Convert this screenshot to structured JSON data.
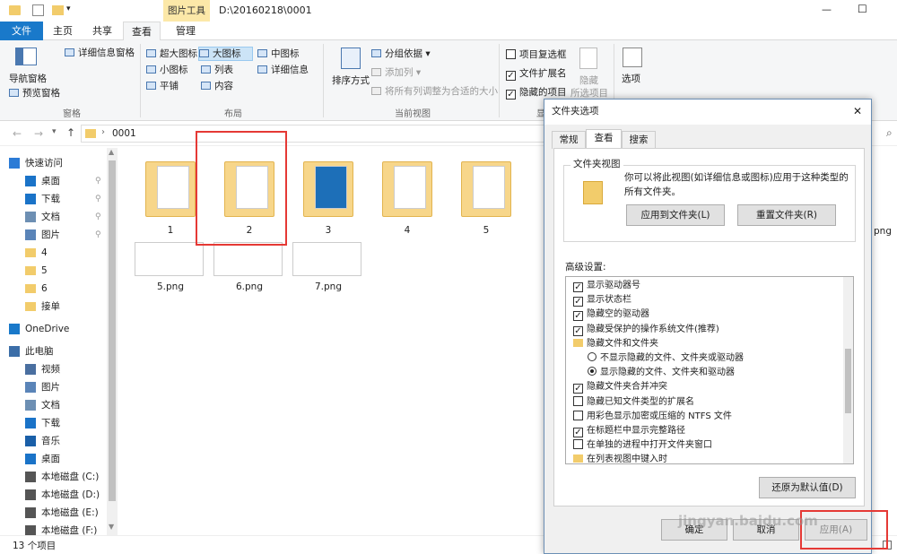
{
  "window": {
    "path": "D:\\20160218\\0001",
    "picture_tools": "图片工具",
    "controls": [
      "—",
      "☐",
      "✕"
    ]
  },
  "ribbon_tabs": [
    "文件",
    "主页",
    "共享",
    "查看",
    "管理"
  ],
  "ribbon": {
    "nav_pane": "导航窗格",
    "preview_pane": "预览窗格",
    "details_pane": "详细信息窗格",
    "group_panes": "窗格",
    "layout": {
      "xlarge": "超大图标",
      "large": "大图标",
      "medium": "中图标",
      "small": "小图标",
      "list": "列表",
      "details": "详细信息",
      "tiles": "平铺",
      "content": "内容"
    },
    "group_layout": "布局",
    "sort_by": "排序方式",
    "group_by": "分组依据",
    "add_columns": "添加列",
    "size_all_columns": "将所有列调整为合适的大小",
    "group_current_view": "当前视图",
    "item_checkboxes": "项目复选框",
    "file_extensions": "文件扩展名",
    "hidden_items": "隐藏的项目",
    "hide": "隐藏",
    "hide_selected": "所选项目",
    "group_show": "显",
    "options": "选项"
  },
  "address": {
    "crumb": "0001"
  },
  "nav": [
    {
      "label": "快速访问",
      "icon": "star-icon"
    },
    {
      "label": "桌面",
      "icon": "desktop-icon",
      "pin": true
    },
    {
      "label": "下载",
      "icon": "download-icon",
      "pin": true
    },
    {
      "label": "文档",
      "icon": "document-icon",
      "pin": true
    },
    {
      "label": "图片",
      "icon": "picture-icon",
      "pin": true
    },
    {
      "label": "4",
      "icon": "folder-icon"
    },
    {
      "label": "5",
      "icon": "folder-icon"
    },
    {
      "label": "6",
      "icon": "folder-icon"
    },
    {
      "label": "接单",
      "icon": "folder-icon"
    },
    {
      "label": "OneDrive",
      "icon": "cloud-icon"
    },
    {
      "label": "此电脑",
      "icon": "computer-icon"
    },
    {
      "label": "视频",
      "icon": "video-icon"
    },
    {
      "label": "图片",
      "icon": "picture-icon"
    },
    {
      "label": "文档",
      "icon": "document-icon"
    },
    {
      "label": "下载",
      "icon": "download-icon"
    },
    {
      "label": "音乐",
      "icon": "music-icon"
    },
    {
      "label": "桌面",
      "icon": "desktop-icon"
    },
    {
      "label": "本地磁盘 (C:)",
      "icon": "drive-icon"
    },
    {
      "label": "本地磁盘 (D:)",
      "icon": "drive-icon"
    },
    {
      "label": "本地磁盘 (E:)",
      "icon": "drive-icon"
    },
    {
      "label": "本地磁盘 (F:)",
      "icon": "drive-icon"
    }
  ],
  "items": {
    "folders": [
      "1",
      "2",
      "3",
      "4",
      "5"
    ],
    "files": [
      "5.png",
      "6.png",
      "7.png"
    ],
    "partial_right": "png"
  },
  "status": {
    "count": "13 个项目"
  },
  "dialog": {
    "title": "文件夹选项",
    "close": "✕",
    "tabs": [
      "常规",
      "查看",
      "搜索"
    ],
    "folder_views": "文件夹视图",
    "folder_views_desc": "你可以将此视图(如详细信息或图标)应用于这种类型的所有文件夹。",
    "apply_to_folders": "应用到文件夹(L)",
    "reset_folders": "重置文件夹(R)",
    "advanced": "高级设置:",
    "adv_items": [
      {
        "type": "check",
        "checked": true,
        "label": "显示驱动器号"
      },
      {
        "type": "check",
        "checked": true,
        "label": "显示状态栏"
      },
      {
        "type": "check",
        "checked": true,
        "label": "隐藏空的驱动器"
      },
      {
        "type": "check",
        "checked": true,
        "label": "隐藏受保护的操作系统文件(推荐)"
      },
      {
        "type": "folder",
        "label": "隐藏文件和文件夹"
      },
      {
        "type": "radio",
        "checked": false,
        "label": "不显示隐藏的文件、文件夹或驱动器"
      },
      {
        "type": "radio",
        "checked": true,
        "label": "显示隐藏的文件、文件夹和驱动器"
      },
      {
        "type": "check",
        "checked": true,
        "label": "隐藏文件夹合并冲突"
      },
      {
        "type": "check",
        "checked": false,
        "label": "隐藏已知文件类型的扩展名"
      },
      {
        "type": "check",
        "checked": false,
        "label": "用彩色显示加密或压缩的 NTFS 文件"
      },
      {
        "type": "check",
        "checked": true,
        "label": "在标题栏中显示完整路径"
      },
      {
        "type": "check",
        "checked": false,
        "label": "在单独的进程中打开文件夹窗口"
      },
      {
        "type": "folder",
        "label": "在列表视图中键入时"
      }
    ],
    "restore_defaults": "还原为默认值(D)",
    "ok": "确定",
    "cancel": "取消",
    "apply": "应用(A)"
  },
  "watermark": "jingyan.baidu.com",
  "colors": {
    "accent": "#1979ca",
    "picture_tools_bg": "#fce8a8",
    "highlight": "#e53935"
  }
}
